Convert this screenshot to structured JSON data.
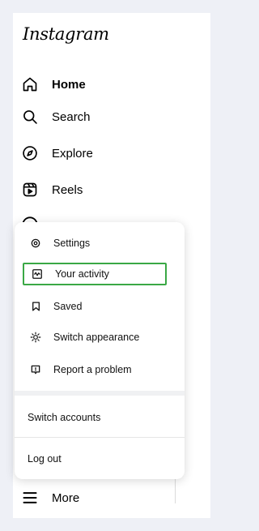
{
  "logo": "Instagram",
  "nav": [
    {
      "label": "Home",
      "icon": "home-icon"
    },
    {
      "label": "Search",
      "icon": "search-icon"
    },
    {
      "label": "Explore",
      "icon": "compass-icon"
    },
    {
      "label": "Reels",
      "icon": "reels-icon"
    }
  ],
  "more": {
    "label": "More",
    "icon": "hamburger-icon"
  },
  "menu": {
    "items": [
      {
        "label": "Settings",
        "icon": "gear-icon"
      },
      {
        "label": "Your activity",
        "icon": "activity-icon"
      },
      {
        "label": "Saved",
        "icon": "bookmark-icon"
      },
      {
        "label": "Switch appearance",
        "icon": "sun-icon"
      },
      {
        "label": "Report a problem",
        "icon": "report-icon"
      }
    ],
    "switch_accounts": "Switch accounts",
    "log_out": "Log out"
  },
  "colors": {
    "highlight": "#3aa845",
    "background": "#eef0f6"
  }
}
